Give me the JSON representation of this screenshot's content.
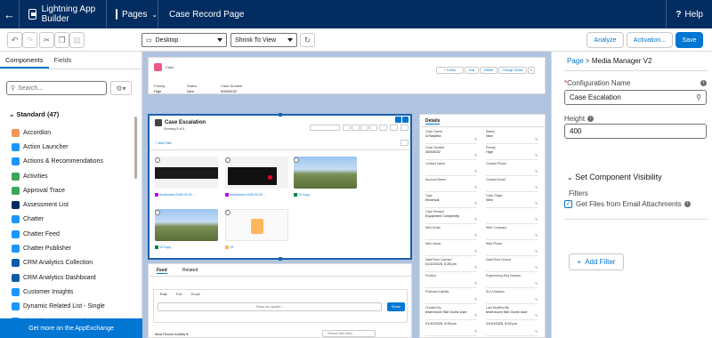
{
  "topbar": {
    "back_icon": "arrow-left-icon",
    "app_name": "Lightning App Builder",
    "pages_label": "Pages",
    "page_title": "Case Record Page",
    "help_label": "Help"
  },
  "toolbar": {
    "device": "Desktop",
    "view_mode": "Shrink To View",
    "analyze_label": "Analyze",
    "activation_label": "Activation...",
    "save_label": "Save"
  },
  "left": {
    "tabs": [
      "Components",
      "Fields"
    ],
    "search_placeholder": "Search...",
    "section_title": "Standard (47)",
    "components": [
      {
        "label": "Accordion",
        "color": "#f49756"
      },
      {
        "label": "Action Launcher",
        "color": "#1b96ff"
      },
      {
        "label": "Actions & Recommendations",
        "color": "#1b96ff"
      },
      {
        "label": "Activities",
        "color": "#3ba755"
      },
      {
        "label": "Approval Trace",
        "color": "#3ba755"
      },
      {
        "label": "Assessment List",
        "color": "#032d60"
      },
      {
        "label": "Chatter",
        "color": "#1b96ff"
      },
      {
        "label": "Chatter Feed",
        "color": "#1b96ff"
      },
      {
        "label": "Chatter Publisher",
        "color": "#1b96ff"
      },
      {
        "label": "CRM Analytics Collection",
        "color": "#0b5cab"
      },
      {
        "label": "CRM Analytics Dashboard",
        "color": "#0b5cab"
      },
      {
        "label": "Customer Insights",
        "color": "#1b96ff"
      },
      {
        "label": "Dynamic Related List - Single",
        "color": "#1b96ff"
      },
      {
        "label": "Einstein Next Best Action",
        "color": "#1b96ff"
      }
    ],
    "appexchange_label": "Get more on the AppExchange"
  },
  "canvas": {
    "record_object": "Case",
    "header_actions": [
      "+ Follow",
      "Edit",
      "Delete",
      "Change Owner"
    ],
    "header_fields": [
      {
        "label": "Priority",
        "value": "High"
      },
      {
        "label": "Status",
        "value": "New"
      },
      {
        "label": "Case Number",
        "value": "00004032"
      }
    ],
    "media": {
      "title": "Case Escalation",
      "subtitle": "Showing 5 of 5",
      "add_filter": "+ Add Filter",
      "files": [
        {
          "name": "Screenshot 2025-09-29 ..."
        },
        {
          "name": "Screenshot 2025-09-29 ..."
        },
        {
          "name": "15 Copy"
        },
        {
          "name": "15 Copy"
        },
        {
          "name": "15"
        }
      ]
    },
    "feed": {
      "tabs": [
        "Feed",
        "Related"
      ],
      "post_tabs": [
        "Post",
        "Poll",
        "Email"
      ],
      "share_placeholder": "Share an update...",
      "share_label": "Share",
      "sort_label": "Most Recent Activity",
      "search_placeholder": "Search this feed..."
    },
    "details": {
      "tab": "Details",
      "fields": [
        {
          "label": "Case Owner",
          "value": "A Ranjitha"
        },
        {
          "label": "Status",
          "value": "New"
        },
        {
          "label": "Case Number",
          "value": "00004032"
        },
        {
          "label": "Priority",
          "value": "High"
        },
        {
          "label": "Contact Name",
          "value": ""
        },
        {
          "label": "Contact Phone",
          "value": ""
        },
        {
          "label": "Account Name",
          "value": ""
        },
        {
          "label": "Contact Email",
          "value": ""
        },
        {
          "label": "Type",
          "value": "Electrical"
        },
        {
          "label": "Case Origin",
          "value": "Web"
        },
        {
          "label": "Case Reason",
          "value": "Equipment Complexity"
        },
        {
          "label": "",
          "value": ""
        },
        {
          "label": "Web Email",
          "value": ""
        },
        {
          "label": "Web Company",
          "value": ""
        },
        {
          "label": "Web Name",
          "value": ""
        },
        {
          "label": "Web Phone",
          "value": ""
        },
        {
          "label": "Date/Time Opened",
          "value": "01/10/2025, 5:28 pm"
        },
        {
          "label": "Date/Time Closed",
          "value": ""
        },
        {
          "label": "Product",
          "value": ""
        },
        {
          "label": "Engineering Req Number",
          "value": ""
        },
        {
          "label": "Potential Liability",
          "value": ""
        },
        {
          "label": "SLA Violation",
          "value": ""
        },
        {
          "label": "Created By",
          "value": "testrnecom Site Guest User"
        },
        {
          "label": "Last Modified By",
          "value": "testrnecom Site Guest User"
        },
        {
          "label": "",
          "value": "01/10/2025, 5:28 pm"
        },
        {
          "label": "",
          "value": "01/10/2025, 5:28 pm"
        },
        {
          "label": "Subject",
          "value": ""
        }
      ]
    }
  },
  "right": {
    "breadcrumb_page": "Page",
    "breadcrumb_sep": ">",
    "component_name": "Media Manager V2",
    "config_label": "Configuration Name",
    "config_value": "Case Escalation",
    "height_label": "Height",
    "height_value": "400",
    "get_files_label": "Get Files from Email Attachments",
    "visibility_label": "Set Component Visibility",
    "filters_label": "Filters",
    "add_filter_label": "Add Filter"
  }
}
